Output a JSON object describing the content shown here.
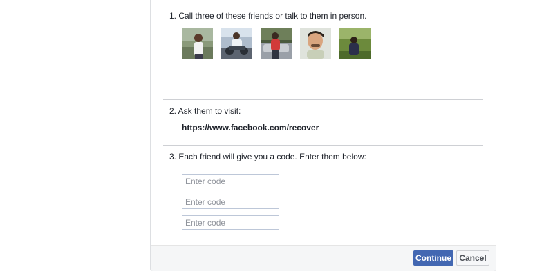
{
  "steps": {
    "step1": "1. Call three of these friends or talk to them in person.",
    "step2": "2. Ask them to visit:",
    "recover_url": "https://www.facebook.com/recover",
    "step3": "3. Each friend will give you a code. Enter them below:"
  },
  "code_inputs": [
    {
      "placeholder": "Enter code",
      "value": ""
    },
    {
      "placeholder": "Enter code",
      "value": ""
    },
    {
      "placeholder": "Enter code",
      "value": ""
    }
  ],
  "footer": {
    "continue_label": "Continue",
    "cancel_label": "Cancel"
  },
  "colors": {
    "primary": "#4267b2",
    "border": "#dddfe2",
    "footer_bg": "#f5f6f7"
  },
  "friends": [
    {
      "icon": "friend-photo"
    },
    {
      "icon": "friend-photo"
    },
    {
      "icon": "friend-photo"
    },
    {
      "icon": "friend-photo"
    },
    {
      "icon": "friend-photo"
    }
  ]
}
